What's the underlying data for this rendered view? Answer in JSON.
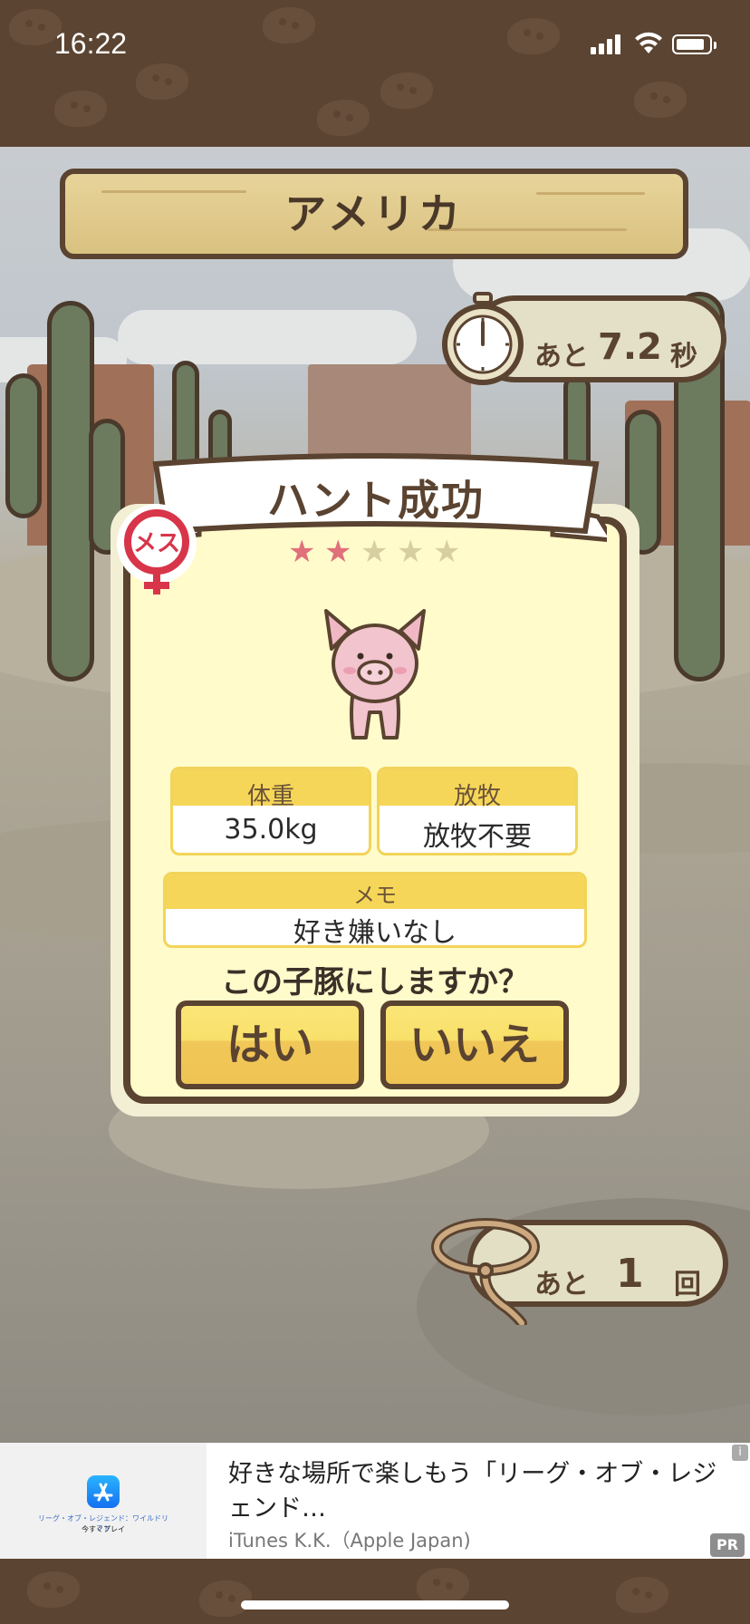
{
  "status_bar": {
    "time": "16:22",
    "icons": [
      "signal-icon",
      "wifi-icon",
      "battery-icon"
    ]
  },
  "location": {
    "country": "アメリカ"
  },
  "timer": {
    "prefix": "あと",
    "value": "7.2",
    "unit": "秒",
    "icon": "stopwatch-icon"
  },
  "result": {
    "title": "ハント成功",
    "gender_badge": "メス",
    "gender_icon": "female-symbol-icon",
    "rating_filled": 2,
    "rating_max": 5,
    "star_filled_color": "#e0707a",
    "star_empty_color": "#d8cfa0"
  },
  "info": {
    "weight_label": "体重",
    "weight_value": "35.0kg",
    "grazing_label": "放牧",
    "grazing_value": "放牧不要",
    "memo_label": "メモ",
    "memo_value": "好き嫌いなし"
  },
  "prompt": {
    "question": "この子豚にしますか？",
    "yes_label": "はい",
    "no_label": "いいえ"
  },
  "attempts": {
    "prefix": "あと",
    "value": "1",
    "unit": "回",
    "icon": "lasso-icon"
  },
  "ad": {
    "title": "好きな場所で楽しもう「リーグ・オブ・レジェンド…",
    "advertiser": "iTunes K.K.（Apple Japan)",
    "pr_badge": "PR",
    "info_badge": "i",
    "app_small_text": "リーグ・オブ・レジェンド：ワイルドリフト",
    "app_small_cta": "今すぐプレイ"
  }
}
